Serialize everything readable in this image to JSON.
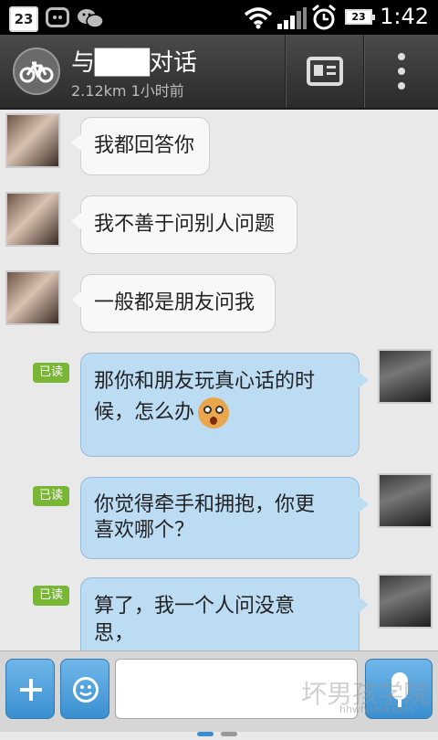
{
  "status_bar": {
    "date_badge": "23",
    "battery": "23",
    "time": "1:42",
    "icons": [
      "calendar-icon",
      "qq-icon",
      "wechat-icon",
      "wifi-icon",
      "signal-icon",
      "alarm-icon",
      "battery-icon"
    ]
  },
  "header": {
    "title": "与███对话",
    "subtitle": "2.12km 1小时前",
    "avatar_icon": "bicycle-icon",
    "profile_icon": "profile-card-icon",
    "more_icon": "more-vertical-icon"
  },
  "messages": [
    {
      "side": "left",
      "text": "我都回答你"
    },
    {
      "side": "left",
      "text": "我不善于问别人问题"
    },
    {
      "side": "left",
      "text": "一般都是朋友问我"
    },
    {
      "side": "right",
      "status": "已读",
      "text_line1": "那你和朋友玩真心话的时",
      "text_line2": "候，怎么办",
      "emoji": "shocked-face-emoji"
    },
    {
      "side": "right",
      "status": "已读",
      "text_line1": "你觉得牵手和拥抱，你更",
      "text_line2": "喜欢哪个？"
    },
    {
      "side": "right",
      "status": "已读",
      "text_line1": "算了，我一个人问没意",
      "text_line2": "思，"
    }
  ],
  "input_bar": {
    "input_value": "",
    "plus_icon": "plus-icon",
    "emoji_icon": "smiley-icon",
    "voice_icon": "microphone-icon"
  },
  "watermark": {
    "text": "坏男孩学院",
    "sub": "hhwhome.com"
  }
}
